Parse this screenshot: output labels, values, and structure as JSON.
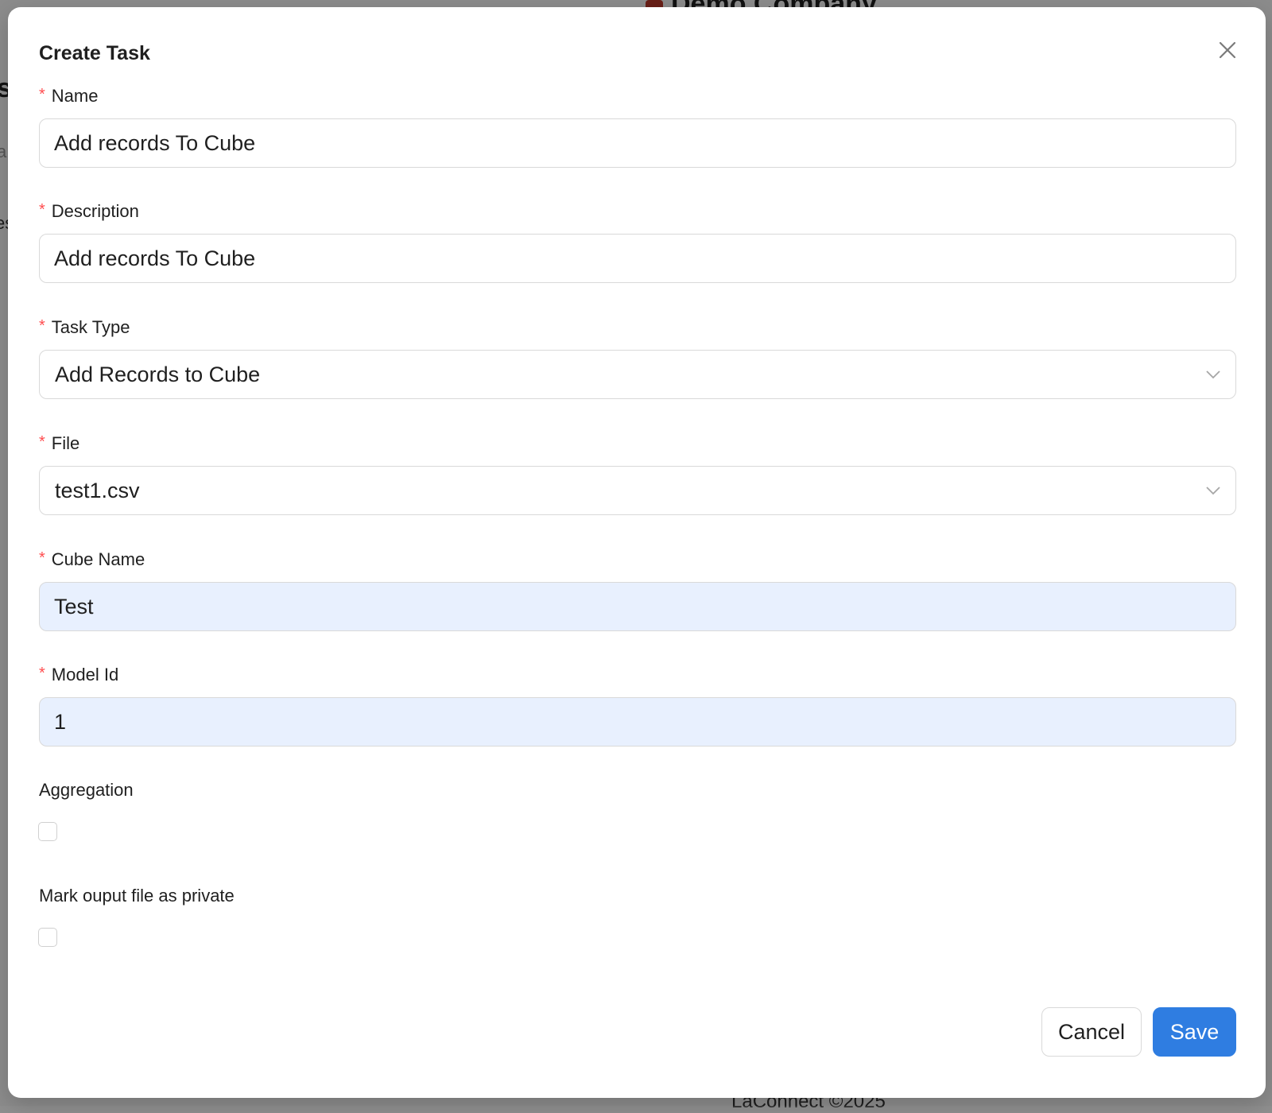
{
  "background": {
    "company_name": "Demo Company",
    "footer_text": "LaConnect ©2025",
    "edge_texts": [
      "s",
      "a",
      "es"
    ]
  },
  "modal": {
    "title": "Create Task",
    "close_icon": "close-icon"
  },
  "fields": {
    "name": {
      "label": "Name",
      "required_mark": "*",
      "value": "Add records To Cube"
    },
    "description": {
      "label": "Description",
      "required_mark": "*",
      "value": "Add records To Cube"
    },
    "task_type": {
      "label": "Task Type",
      "required_mark": "*",
      "selected": "Add Records to Cube",
      "icon": "chevron-down-icon"
    },
    "file": {
      "label": "File",
      "required_mark": "*",
      "selected": "test1.csv",
      "icon": "chevron-down-icon"
    },
    "cube_name": {
      "label": "Cube Name",
      "required_mark": "*",
      "value": "Test"
    },
    "model_id": {
      "label": "Model Id",
      "required_mark": "*",
      "value": "1"
    },
    "aggregation": {
      "label": "Aggregation",
      "checked": false
    },
    "mark_private": {
      "label": "Mark ouput file as private",
      "checked": false
    }
  },
  "footer": {
    "cancel_label": "Cancel",
    "save_label": "Save"
  },
  "colors": {
    "primary": "#2f7de1",
    "required": "#ff4d4f",
    "autofill_bg": "#e8f0fe",
    "border": "#d9d9d9"
  }
}
